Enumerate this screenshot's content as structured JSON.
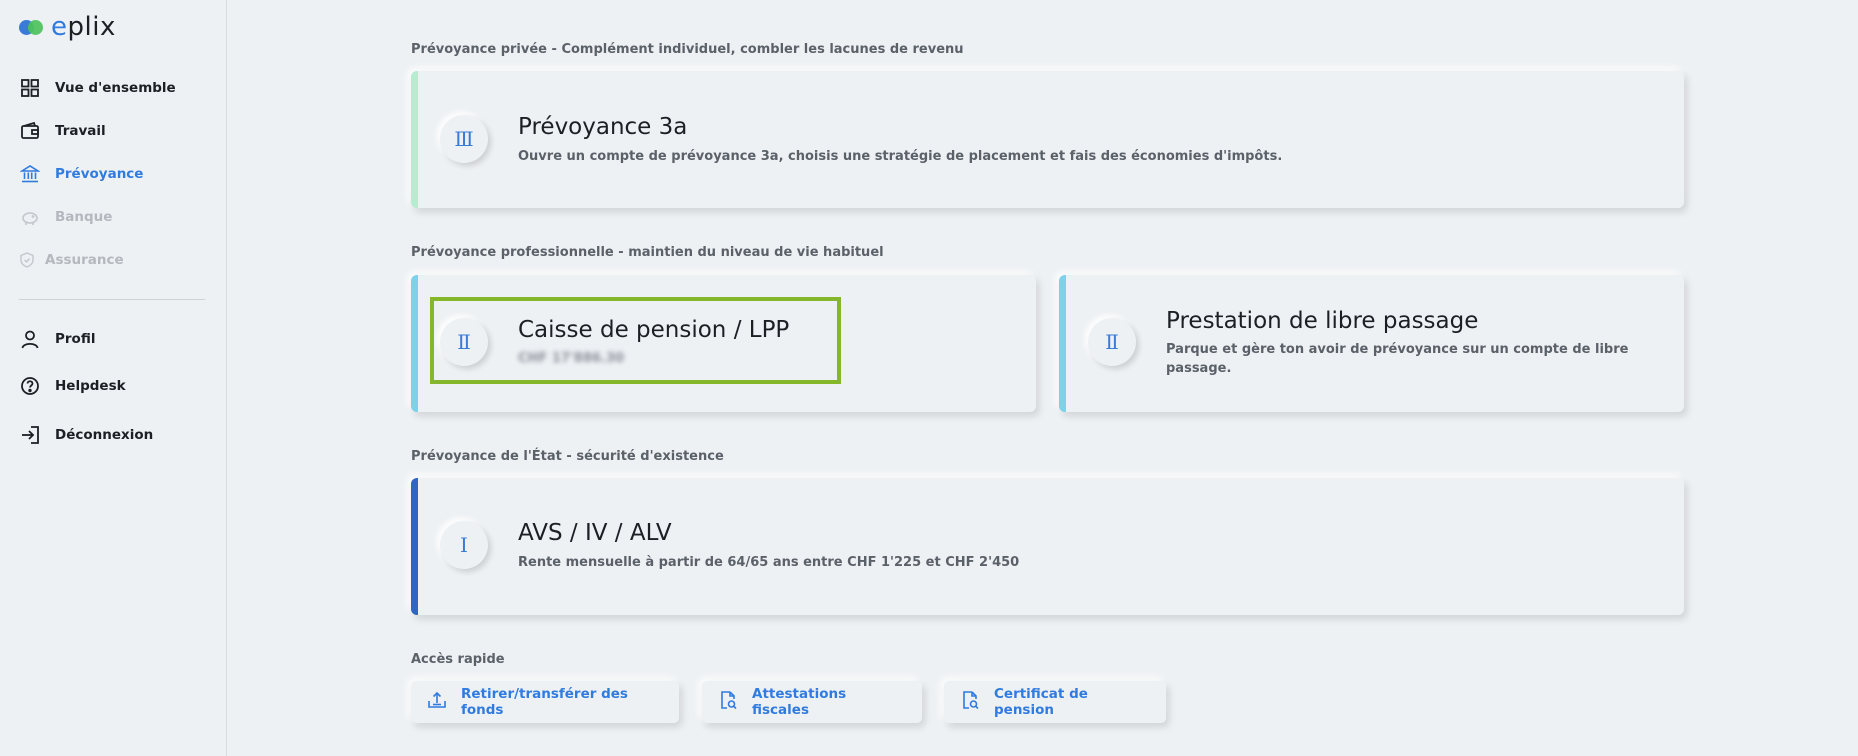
{
  "brand": {
    "name": "eplix",
    "first_letter": "e",
    "rest": "plix"
  },
  "sidebar": {
    "items": [
      {
        "label": "Vue d'ensemble",
        "icon": "grid-icon",
        "state": "normal"
      },
      {
        "label": "Travail",
        "icon": "wallet-icon",
        "state": "normal"
      },
      {
        "label": "Prévoyance",
        "icon": "bank-icon",
        "state": "active"
      },
      {
        "label": "Banque",
        "icon": "piggy-bank-icon",
        "state": "disabled"
      },
      {
        "label": "Assurance",
        "icon": "shield-icon",
        "state": "disabled"
      }
    ],
    "secondary": [
      {
        "label": "Profil",
        "icon": "user-icon"
      },
      {
        "label": "Helpdesk",
        "icon": "help-icon"
      },
      {
        "label": "Déconnexion",
        "icon": "logout-icon"
      }
    ]
  },
  "sections": {
    "private": {
      "title": "Prévoyance privée - Complément individuel, combler les lacunes de revenu"
    },
    "professional": {
      "title": "Prévoyance professionnelle - maintien du niveau de vie habituel"
    },
    "state": {
      "title": "Prévoyance de l'État - sécurité d'existence"
    },
    "quick": {
      "title": "Accès rapide"
    }
  },
  "cards": {
    "pillar3a": {
      "numeral": "Ⅲ",
      "title": "Prévoyance 3a",
      "desc": "Ouvre un compte de prévoyance 3a, choisis une stratégie de placement et fais des économies d'impôts."
    },
    "lpp": {
      "numeral": "Ⅱ",
      "title": "Caisse de pension / LPP",
      "desc": "CHF 17'886.30"
    },
    "libre": {
      "numeral": "Ⅱ",
      "title": "Prestation de libre passage",
      "desc_line1": "Parque et gère ton avoir de prévoyance sur un compte de libre",
      "desc_line2": "passage."
    },
    "avs": {
      "numeral": "Ⅰ",
      "title": "AVS / IV / ALV",
      "desc": "Rente mensuelle à partir de 64/65 ans entre CHF 1'225 et CHF 2'450"
    }
  },
  "quick_access": [
    {
      "label": "Retirer/transférer des fonds",
      "icon": "upload-icon"
    },
    {
      "label": "Attestations fiscales",
      "icon": "document-search-icon"
    },
    {
      "label": "Certificat de pension",
      "icon": "document-search-icon"
    }
  ],
  "colors": {
    "accent": "#2f7be0",
    "stripe_3a": "#b6ecd0",
    "stripe_2": "#7fd0ea",
    "stripe_1": "#2e66c2",
    "highlight": "#85b72b"
  }
}
